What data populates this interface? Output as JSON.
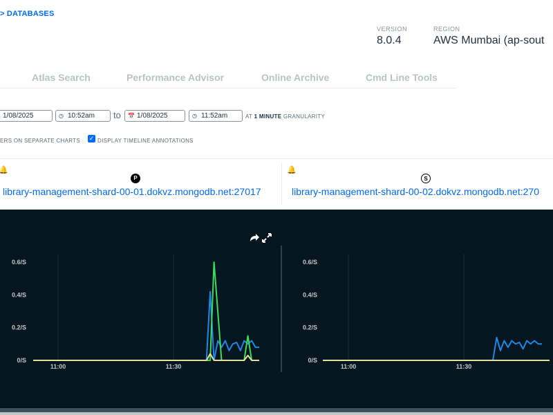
{
  "breadcrumb": "> DATABASES",
  "meta": {
    "version_label": "VERSION",
    "version_value": "8.0.4",
    "region_label": "REGION",
    "region_value": "AWS Mumbai (ap-sout"
  },
  "tabs": [
    {
      "label": "Atlas Search"
    },
    {
      "label": "Performance Advisor"
    },
    {
      "label": "Online Archive"
    },
    {
      "label": "Cmd Line Tools"
    }
  ],
  "time_range": {
    "start_date": "1/08/2025",
    "start_time": "10:52am",
    "to_label": "to",
    "end_date": "1/08/2025",
    "end_time": "11:52am",
    "granularity_prefix": "AT",
    "granularity_value": "1 MINUTE",
    "granularity_suffix": "GRANULARITY"
  },
  "options": {
    "separate_charts": "ERS ON SEPARATE CHARTS",
    "timeline_annotations": "DISPLAY TIMELINE ANNOTATIONS",
    "timeline_annotations_checked": true
  },
  "hosts": [
    {
      "role": "P",
      "name": "library-management-shard-00-01.dokvz.mongodb.net:27017"
    },
    {
      "role": "S",
      "name": "library-management-shard-00-02.dokvz.mongodb.net:270"
    }
  ],
  "colors": {
    "chart_bg": "#061621",
    "series_blue": "#1e88e5",
    "series_green": "#3ddc5c",
    "series_yellow": "#e6e09a",
    "link": "#016bf8"
  },
  "icons": {
    "calendar": "calendar-icon",
    "clock": "clock-icon",
    "bell": "bell-icon",
    "share": "share-icon",
    "expand": "expand-icon"
  },
  "chart_data": [
    {
      "type": "line",
      "yticks": [
        "0.6/S",
        "0.4/S",
        "0.2/S",
        "0/S"
      ],
      "xticks": [
        "11:00",
        "11:30"
      ],
      "ylim": [
        0,
        0.6
      ],
      "x_unit": "minutes from 10:52",
      "xlim": [
        0,
        60
      ],
      "series": [
        {
          "color": "#1e88e5",
          "points": [
            [
              0,
              0
            ],
            [
              46,
              0
            ],
            [
              47,
              0.42
            ],
            [
              48,
              0
            ],
            [
              49,
              0.12
            ],
            [
              50,
              0.08
            ],
            [
              51,
              0.12
            ],
            [
              52,
              0.06
            ],
            [
              53,
              0.1
            ],
            [
              54,
              0.11
            ],
            [
              55,
              0.06
            ],
            [
              56,
              0.12
            ],
            [
              57,
              0.1
            ],
            [
              58,
              0.12
            ],
            [
              59,
              0.08
            ],
            [
              60,
              0.08
            ]
          ]
        },
        {
          "color": "#3ddc5c",
          "points": [
            [
              0,
              0
            ],
            [
              47,
              0
            ],
            [
              48,
              0.6
            ],
            [
              50,
              0
            ],
            [
              56,
              0
            ],
            [
              57,
              0.15
            ],
            [
              58,
              0
            ]
          ]
        },
        {
          "color": "#e6e09a",
          "points": [
            [
              0,
              0
            ],
            [
              46,
              0
            ],
            [
              47,
              0.04
            ],
            [
              48,
              0
            ],
            [
              56,
              0
            ],
            [
              57,
              0.03
            ],
            [
              58,
              0
            ],
            [
              60,
              0
            ]
          ]
        }
      ]
    },
    {
      "type": "line",
      "yticks": [
        "0.6/S",
        "0.4/S",
        "0.2/S",
        "0/S"
      ],
      "xticks": [
        "11:00",
        "11:30"
      ],
      "ylim": [
        0,
        0.6
      ],
      "x_unit": "minutes from 10:52",
      "xlim": [
        0,
        60
      ],
      "series": [
        {
          "color": "#1e88e5",
          "points": [
            [
              0,
              0
            ],
            [
              45,
              0
            ],
            [
              46,
              0.14
            ],
            [
              47,
              0.06
            ],
            [
              48,
              0.12
            ],
            [
              49,
              0.08
            ],
            [
              50,
              0.12
            ],
            [
              51,
              0.1
            ],
            [
              52,
              0.11
            ],
            [
              53,
              0.07
            ],
            [
              54,
              0.12
            ],
            [
              55,
              0.1
            ],
            [
              56,
              0.12
            ],
            [
              57,
              0.1
            ],
            [
              58,
              0.1
            ]
          ]
        },
        {
          "color": "#e6e09a",
          "points": [
            [
              0,
              0
            ],
            [
              60,
              0
            ]
          ]
        }
      ]
    }
  ]
}
